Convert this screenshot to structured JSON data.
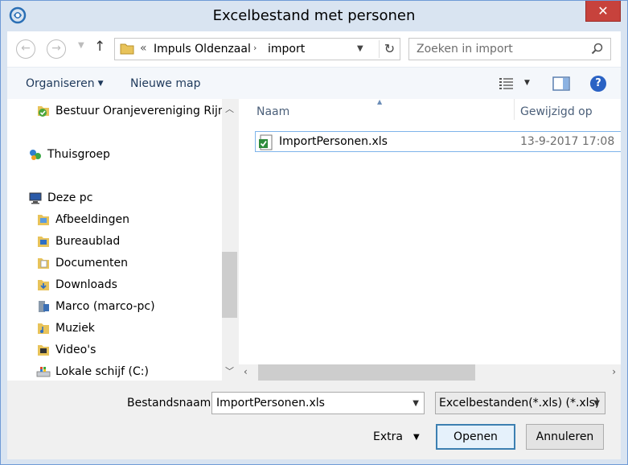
{
  "window": {
    "title": "Excelbestand met personen",
    "close_glyph": "✕"
  },
  "navigation": {
    "back_icon": "arrow-left-icon",
    "forward_icon": "arrow-right-icon",
    "up_icon": "arrow-up-icon",
    "address": {
      "chevron": "«",
      "segments": [
        "Impuls Oldenzaal",
        "import"
      ],
      "separator": "›"
    },
    "search_placeholder": "Zoeken in import"
  },
  "toolbar": {
    "organize_label": "Organiseren",
    "new_folder_label": "Nieuwe map",
    "help_glyph": "?"
  },
  "navpane": {
    "items": [
      {
        "label": "Bestuur Oranjevereniging Rijnsa",
        "icon": "excel-folder-icon"
      },
      {
        "label": "Thuisgroep",
        "icon": "homegroup-icon"
      },
      {
        "label": "Deze pc",
        "icon": "computer-icon"
      },
      {
        "label": "Afbeeldingen",
        "icon": "folder-pictures-icon"
      },
      {
        "label": "Bureaublad",
        "icon": "folder-desktop-icon"
      },
      {
        "label": "Documenten",
        "icon": "folder-documents-icon"
      },
      {
        "label": "Downloads",
        "icon": "folder-downloads-icon"
      },
      {
        "label": "Marco (marco-pc)",
        "icon": "user-network-icon"
      },
      {
        "label": "Muziek",
        "icon": "folder-music-icon"
      },
      {
        "label": "Video's",
        "icon": "folder-videos-icon"
      },
      {
        "label": "Lokale schijf (C:)",
        "icon": "drive-icon"
      }
    ]
  },
  "filelist": {
    "columns": [
      "Naam",
      "Gewijzigd op"
    ],
    "rows": [
      {
        "name": "ImportPersonen.xls",
        "modified": "13-9-2017 17:08",
        "icon": "excel-file-icon"
      }
    ]
  },
  "footer": {
    "filename_label": "Bestandsnaam:",
    "filename_value": "ImportPersonen.xls",
    "filetype_value": "Excelbestanden(*.xls) (*.xls)",
    "extra_label": "Extra",
    "open_label": "Openen",
    "cancel_label": "Annuleren"
  },
  "colors": {
    "accent": "#3c7fb1",
    "close": "#c7423c",
    "selection_border": "#7eb4ea"
  }
}
